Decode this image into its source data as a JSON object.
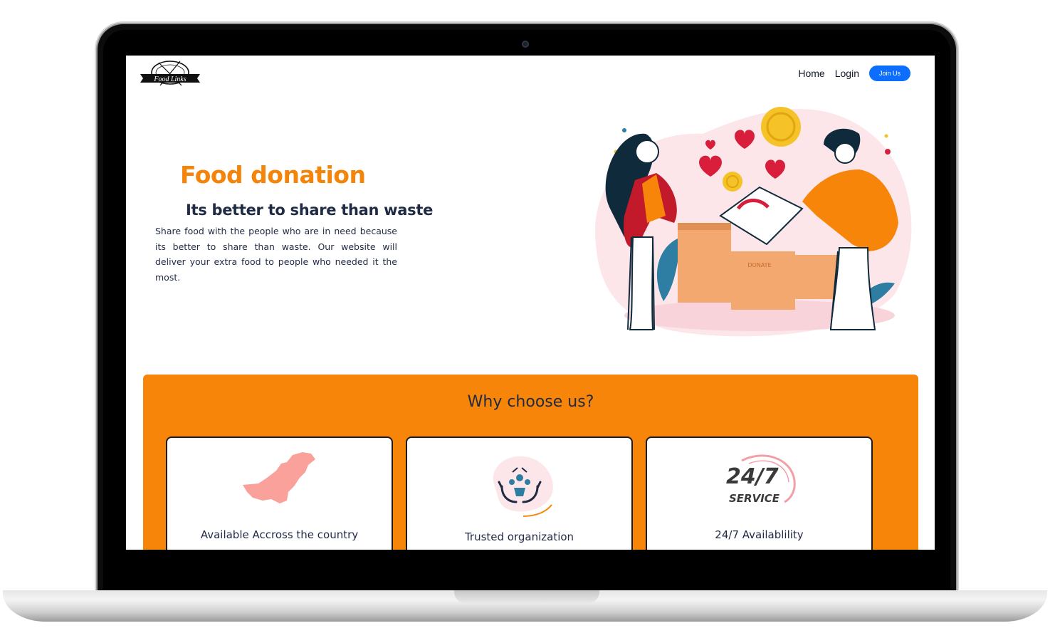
{
  "colors": {
    "accent": "#f7850a",
    "heading": "#f5850a",
    "text": "#1f2a44",
    "button": "#0d6efd"
  },
  "nav": {
    "logo_text": "Food Links",
    "home": "Home",
    "login": "Login",
    "join": "Join Us"
  },
  "hero": {
    "title": "Food donation",
    "subtitle": "Its better to share than waste",
    "text": "Share food with the people who are in need because its better to share than waste. Our website will deliver your extra food to people who needed it the most.",
    "box_label": "DONATE"
  },
  "why": {
    "title": "Why choose us?",
    "cards": [
      {
        "label": "Available Accross the country",
        "icon": "pakistan-map-icon"
      },
      {
        "label": "Trusted organization",
        "icon": "hands-people-icon"
      },
      {
        "label": "24/7 Availablility",
        "icon": "24-7-service-icon"
      }
    ],
    "service_badge_main": "24/7",
    "service_badge_sub": "SERVICE"
  }
}
